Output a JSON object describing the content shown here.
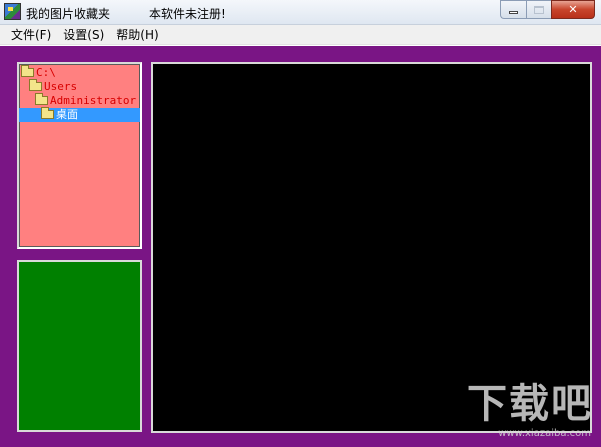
{
  "window": {
    "title": "我的图片收藏夹",
    "status_text": "本软件未注册!",
    "minimize_icon": "minimize-icon",
    "maximize_icon": "maximize-icon",
    "close_label": "✕"
  },
  "menu": {
    "items": [
      {
        "label": "文件(F)"
      },
      {
        "label": "设置(S)"
      },
      {
        "label": "帮助(H)"
      }
    ]
  },
  "tree": {
    "nodes": [
      {
        "label": "C:\\",
        "depth": 0,
        "selected": false
      },
      {
        "label": "Users",
        "depth": 1,
        "selected": false
      },
      {
        "label": "Administrator",
        "depth": 2,
        "selected": false
      },
      {
        "label": "桌面",
        "depth": 3,
        "selected": true
      }
    ]
  },
  "watermark": {
    "text": "下载吧",
    "url": "www.xiazaiba.com"
  },
  "colors": {
    "client_bg": "#7a1585",
    "tree_bg": "#ff8080",
    "preview_bg": "#008000",
    "viewer_bg": "#000000",
    "selection": "#3399ff"
  }
}
